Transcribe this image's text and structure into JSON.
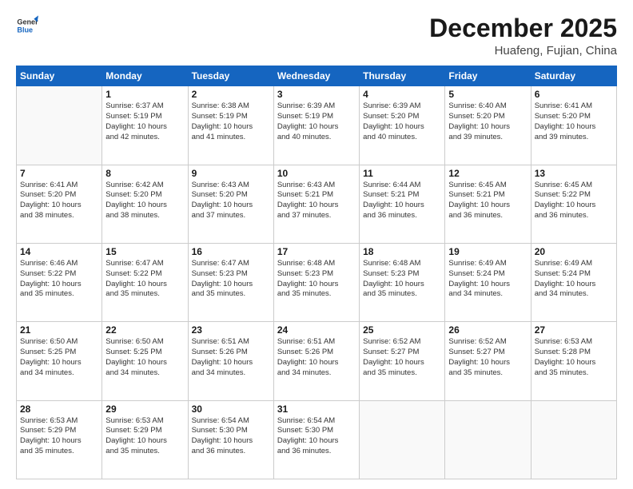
{
  "logo": {
    "line1": "General",
    "line2": "Blue"
  },
  "title": "December 2025",
  "location": "Huafeng, Fujian, China",
  "weekdays": [
    "Sunday",
    "Monday",
    "Tuesday",
    "Wednesday",
    "Thursday",
    "Friday",
    "Saturday"
  ],
  "weeks": [
    [
      {
        "day": "",
        "info": ""
      },
      {
        "day": "1",
        "info": "Sunrise: 6:37 AM\nSunset: 5:19 PM\nDaylight: 10 hours\nand 42 minutes."
      },
      {
        "day": "2",
        "info": "Sunrise: 6:38 AM\nSunset: 5:19 PM\nDaylight: 10 hours\nand 41 minutes."
      },
      {
        "day": "3",
        "info": "Sunrise: 6:39 AM\nSunset: 5:19 PM\nDaylight: 10 hours\nand 40 minutes."
      },
      {
        "day": "4",
        "info": "Sunrise: 6:39 AM\nSunset: 5:20 PM\nDaylight: 10 hours\nand 40 minutes."
      },
      {
        "day": "5",
        "info": "Sunrise: 6:40 AM\nSunset: 5:20 PM\nDaylight: 10 hours\nand 39 minutes."
      },
      {
        "day": "6",
        "info": "Sunrise: 6:41 AM\nSunset: 5:20 PM\nDaylight: 10 hours\nand 39 minutes."
      }
    ],
    [
      {
        "day": "7",
        "info": "Sunrise: 6:41 AM\nSunset: 5:20 PM\nDaylight: 10 hours\nand 38 minutes."
      },
      {
        "day": "8",
        "info": "Sunrise: 6:42 AM\nSunset: 5:20 PM\nDaylight: 10 hours\nand 38 minutes."
      },
      {
        "day": "9",
        "info": "Sunrise: 6:43 AM\nSunset: 5:20 PM\nDaylight: 10 hours\nand 37 minutes."
      },
      {
        "day": "10",
        "info": "Sunrise: 6:43 AM\nSunset: 5:21 PM\nDaylight: 10 hours\nand 37 minutes."
      },
      {
        "day": "11",
        "info": "Sunrise: 6:44 AM\nSunset: 5:21 PM\nDaylight: 10 hours\nand 36 minutes."
      },
      {
        "day": "12",
        "info": "Sunrise: 6:45 AM\nSunset: 5:21 PM\nDaylight: 10 hours\nand 36 minutes."
      },
      {
        "day": "13",
        "info": "Sunrise: 6:45 AM\nSunset: 5:22 PM\nDaylight: 10 hours\nand 36 minutes."
      }
    ],
    [
      {
        "day": "14",
        "info": "Sunrise: 6:46 AM\nSunset: 5:22 PM\nDaylight: 10 hours\nand 35 minutes."
      },
      {
        "day": "15",
        "info": "Sunrise: 6:47 AM\nSunset: 5:22 PM\nDaylight: 10 hours\nand 35 minutes."
      },
      {
        "day": "16",
        "info": "Sunrise: 6:47 AM\nSunset: 5:23 PM\nDaylight: 10 hours\nand 35 minutes."
      },
      {
        "day": "17",
        "info": "Sunrise: 6:48 AM\nSunset: 5:23 PM\nDaylight: 10 hours\nand 35 minutes."
      },
      {
        "day": "18",
        "info": "Sunrise: 6:48 AM\nSunset: 5:23 PM\nDaylight: 10 hours\nand 35 minutes."
      },
      {
        "day": "19",
        "info": "Sunrise: 6:49 AM\nSunset: 5:24 PM\nDaylight: 10 hours\nand 34 minutes."
      },
      {
        "day": "20",
        "info": "Sunrise: 6:49 AM\nSunset: 5:24 PM\nDaylight: 10 hours\nand 34 minutes."
      }
    ],
    [
      {
        "day": "21",
        "info": "Sunrise: 6:50 AM\nSunset: 5:25 PM\nDaylight: 10 hours\nand 34 minutes."
      },
      {
        "day": "22",
        "info": "Sunrise: 6:50 AM\nSunset: 5:25 PM\nDaylight: 10 hours\nand 34 minutes."
      },
      {
        "day": "23",
        "info": "Sunrise: 6:51 AM\nSunset: 5:26 PM\nDaylight: 10 hours\nand 34 minutes."
      },
      {
        "day": "24",
        "info": "Sunrise: 6:51 AM\nSunset: 5:26 PM\nDaylight: 10 hours\nand 34 minutes."
      },
      {
        "day": "25",
        "info": "Sunrise: 6:52 AM\nSunset: 5:27 PM\nDaylight: 10 hours\nand 35 minutes."
      },
      {
        "day": "26",
        "info": "Sunrise: 6:52 AM\nSunset: 5:27 PM\nDaylight: 10 hours\nand 35 minutes."
      },
      {
        "day": "27",
        "info": "Sunrise: 6:53 AM\nSunset: 5:28 PM\nDaylight: 10 hours\nand 35 minutes."
      }
    ],
    [
      {
        "day": "28",
        "info": "Sunrise: 6:53 AM\nSunset: 5:29 PM\nDaylight: 10 hours\nand 35 minutes."
      },
      {
        "day": "29",
        "info": "Sunrise: 6:53 AM\nSunset: 5:29 PM\nDaylight: 10 hours\nand 35 minutes."
      },
      {
        "day": "30",
        "info": "Sunrise: 6:54 AM\nSunset: 5:30 PM\nDaylight: 10 hours\nand 36 minutes."
      },
      {
        "day": "31",
        "info": "Sunrise: 6:54 AM\nSunset: 5:30 PM\nDaylight: 10 hours\nand 36 minutes."
      },
      {
        "day": "",
        "info": ""
      },
      {
        "day": "",
        "info": ""
      },
      {
        "day": "",
        "info": ""
      }
    ]
  ]
}
